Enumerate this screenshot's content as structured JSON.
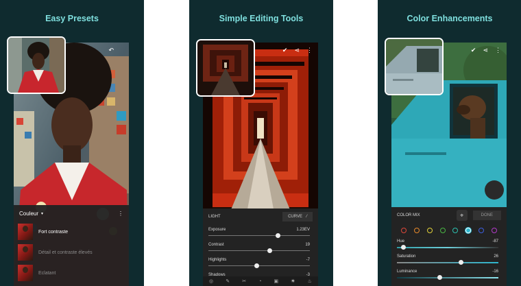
{
  "colors": {
    "panel_bg": "#0f2b2f",
    "title": "#7fe0df",
    "accent": "#2eb7cf"
  },
  "panels": [
    {
      "title": "Easy Presets",
      "preset_group": "Couleur",
      "presets": [
        {
          "label": "Fort contraste"
        },
        {
          "label": "Détail et contraste élevés"
        },
        {
          "label": "Eclatant"
        }
      ],
      "icons": [
        "undo-icon",
        "chevron-down-icon",
        "more-vertical-icon"
      ]
    },
    {
      "title": "Simple Editing Tools",
      "section_label": "LIGHT",
      "curve_label": "CURVE",
      "sliders": [
        {
          "label": "Exposure",
          "value": "1.23EV",
          "level": 0.68
        },
        {
          "label": "Contrast",
          "value": "19",
          "level": 0.6
        },
        {
          "label": "Highlights",
          "value": "-7",
          "level": 0.47
        },
        {
          "label": "Shadows",
          "value": "-3",
          "level": 0.49
        }
      ],
      "icons": [
        "check-circle-icon",
        "share-icon",
        "more-vertical-icon"
      ]
    },
    {
      "title": "Color Enhancements",
      "section_label": "COLOR MIX",
      "done_label": "DONE",
      "color_swatches": [
        "#e0483a",
        "#e8892b",
        "#e3d33a",
        "#49b844",
        "#2cc1b0",
        "#2eb7cf",
        "#3d5fe0",
        "#b43bcb"
      ],
      "selected_swatch": 5,
      "sliders": [
        {
          "label": "Hue",
          "value": "-87",
          "level": 0.06
        },
        {
          "label": "Saturation",
          "value": "26",
          "level": 0.63
        },
        {
          "label": "Luminance",
          "value": "-16",
          "level": 0.42
        }
      ],
      "icons": [
        "check-circle-icon",
        "share-icon",
        "more-vertical-icon",
        "target-adjust-icon"
      ]
    }
  ]
}
